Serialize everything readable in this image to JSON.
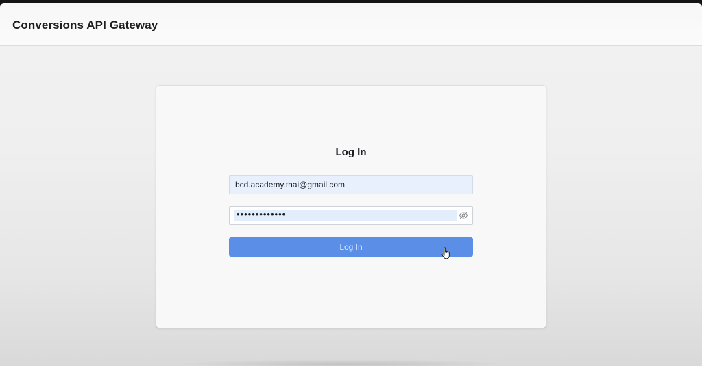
{
  "header": {
    "app_title": "Conversions API Gateway"
  },
  "login": {
    "heading": "Log In",
    "email_value": "bcd.academy.thai@gmail.com",
    "password_mask": "•••••••••••••",
    "button_label": "Log In"
  },
  "icons": {
    "password_toggle": "eye-slash-icon",
    "cursor": "hand-pointer-cursor"
  },
  "colors": {
    "button_bg": "#5b8ee6",
    "autofill_bg": "#e8f0fe"
  }
}
